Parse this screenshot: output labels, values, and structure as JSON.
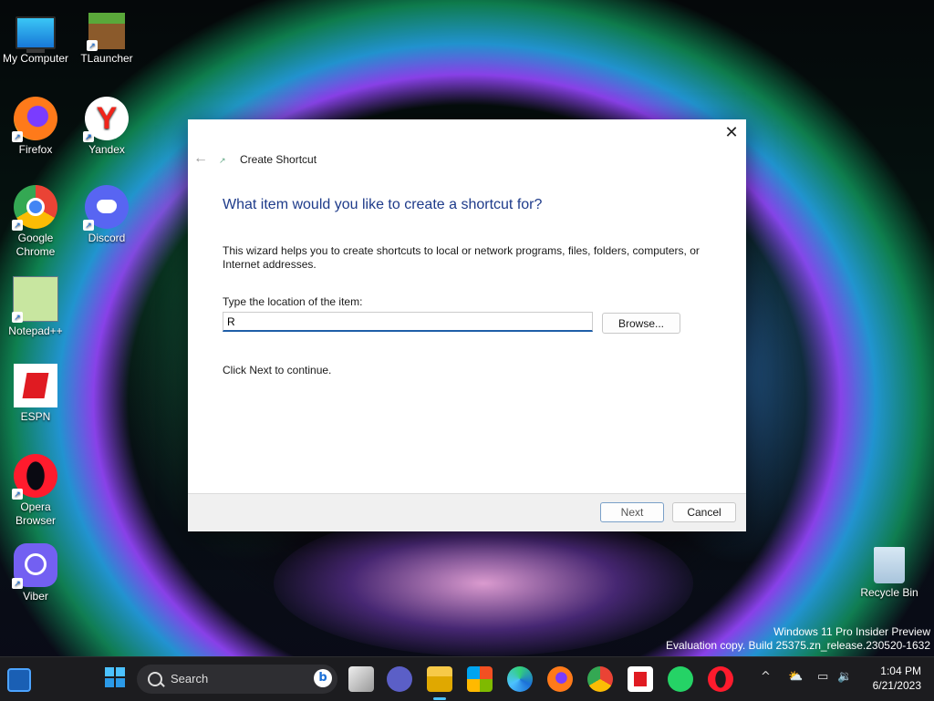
{
  "desktop": {
    "icons": [
      {
        "label": "My Computer",
        "icon": "monitor-icon"
      },
      {
        "label": "TLauncher",
        "icon": "minecraft-block-icon"
      },
      {
        "label": "Firefox",
        "icon": "firefox-icon"
      },
      {
        "label": "Yandex",
        "icon": "yandex-icon",
        "glyph": "Y"
      },
      {
        "label": "Google Chrome",
        "icon": "chrome-icon"
      },
      {
        "label": "Discord",
        "icon": "discord-icon"
      },
      {
        "label": "Notepad++",
        "icon": "notepadpp-icon"
      },
      {
        "label": "ESPN",
        "icon": "espn-icon"
      },
      {
        "label": "Opera Browser",
        "icon": "opera-icon"
      },
      {
        "label": "Viber",
        "icon": "viber-icon"
      },
      {
        "label": "Recycle Bin",
        "icon": "recycle-bin-icon"
      }
    ],
    "watermark": {
      "line1": "Windows 11 Pro Insider Preview",
      "line2": "Evaluation copy. Build 25375.zn_release.230520-1632"
    }
  },
  "dialog": {
    "title": "Create Shortcut",
    "close_glyph": "✕",
    "back_glyph": "←",
    "heading": "What item would you like to create a shortcut for?",
    "description": "This wizard helps you to create shortcuts to local or network programs, files, folders, computers, or Internet addresses.",
    "location_label": "Type the location of the item:",
    "location_value": "R",
    "browse_label": "Browse...",
    "hint": "Click Next to continue.",
    "next_label": "Next",
    "cancel_label": "Cancel"
  },
  "taskbar": {
    "search_text": "Search",
    "bing_glyph": "b",
    "pinned": [
      "widgets-icon",
      "start-icon",
      "task-view-icon",
      "teams-chat-icon",
      "file-explorer-icon",
      "store-icon",
      "edge-icon",
      "firefox-icon",
      "chrome-icon",
      "espn-icon",
      "whatsapp-icon",
      "opera-icon"
    ],
    "tray": {
      "chevron": "^",
      "network": "⛅",
      "display": "▭",
      "volume": "🔉"
    },
    "clock": {
      "time": "1:04 PM",
      "date": "6/21/2023"
    }
  },
  "colors": {
    "accent": "#1f5ea8",
    "heading": "#1e3b8a",
    "taskbar": "#1c1c1f"
  }
}
